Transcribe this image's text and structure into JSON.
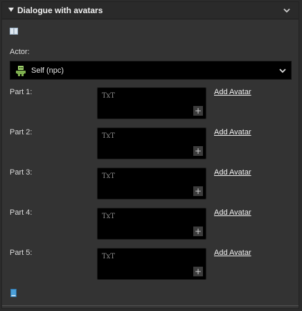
{
  "header": {
    "title": "Dialogue with avatars"
  },
  "actor": {
    "label": "Actor:",
    "selected": "Self (npc)"
  },
  "parts": [
    {
      "label": "Part 1:",
      "placeholder": "TxT",
      "add_label": "Add Avatar"
    },
    {
      "label": "Part 2:",
      "placeholder": "TxT",
      "add_label": "Add Avatar"
    },
    {
      "label": "Part 3:",
      "placeholder": "TxT",
      "add_label": "Add Avatar"
    },
    {
      "label": "Part 4:",
      "placeholder": "TxT",
      "add_label": "Add Avatar"
    },
    {
      "label": "Part 5:",
      "placeholder": "TxT",
      "add_label": "Add Avatar"
    }
  ],
  "plus_symbol": "+",
  "colors": {
    "background": "#333333",
    "field": "#000000",
    "accent_book": "#4a9fd8"
  }
}
